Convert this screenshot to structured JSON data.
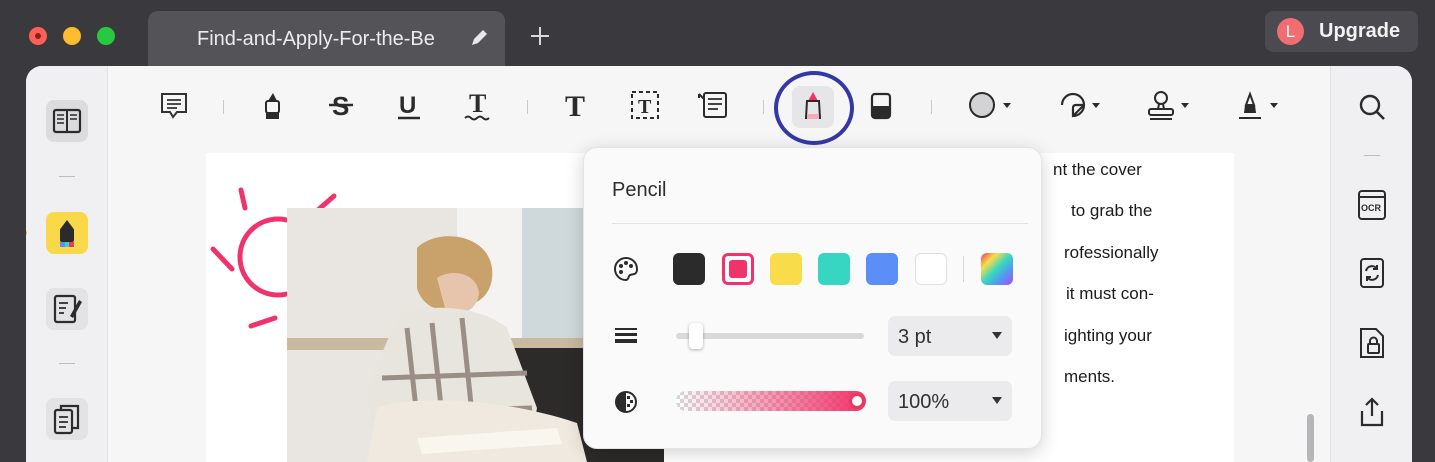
{
  "window": {
    "tab_title": "Find-and-Apply-For-the-Be",
    "upgrade_label": "Upgrade",
    "avatar_letter": "L"
  },
  "colors": {
    "accent_pencil": "#f0336a",
    "highlight_circle": "#3338a8",
    "sidebar_active": "#f9d84a"
  },
  "toolbar": {
    "items": [
      "comment-icon",
      "highlight-icon",
      "strikethrough-icon",
      "underline-icon",
      "squiggly-icon",
      "text-icon",
      "textbox-icon",
      "callout-icon",
      "pencil-icon",
      "eraser-icon",
      "shape-icon",
      "sticker-icon",
      "stamp-icon",
      "signature-icon"
    ]
  },
  "document": {
    "lines": [
      "nt the cover",
      "to grab the",
      "rofessionally",
      "it must con-",
      "ighting your",
      "ments."
    ]
  },
  "pencil_popover": {
    "title": "Pencil",
    "colors": [
      "#2b2b2b",
      "#f0336a",
      "#f9dc4a",
      "#36d6c3",
      "#5b8ef6",
      "#ffffff"
    ],
    "selected_color": "#f0336a",
    "thickness": {
      "value_label": "3 pt",
      "level": 0.08
    },
    "opacity": {
      "value_label": "100%",
      "level": 1.0
    }
  }
}
